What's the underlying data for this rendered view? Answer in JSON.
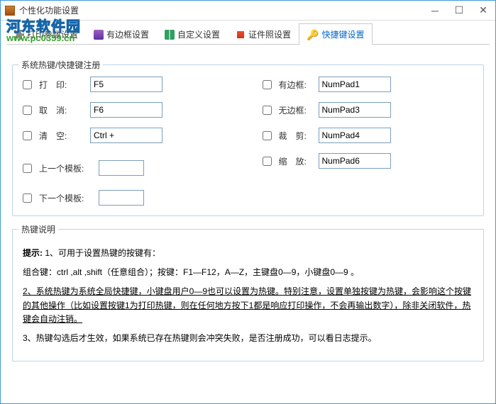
{
  "window": {
    "title": "个性化功能设置"
  },
  "tabs": {
    "items": [
      {
        "label": "打印参数设置"
      },
      {
        "label": "有边框设置"
      },
      {
        "label": "自定义设置"
      },
      {
        "label": "证件照设置"
      },
      {
        "label": "快捷键设置"
      }
    ]
  },
  "watermark": {
    "top_a": "河",
    "top_b": "东",
    "top_c": "软件园",
    "bottom": "www.pc0359.cn"
  },
  "hotkeys": {
    "legend": "系统热键/快捷键注册",
    "left": [
      {
        "label": "打　印:",
        "value": "F5"
      },
      {
        "label": "取　消:",
        "value": "F6"
      },
      {
        "label": "清　空:",
        "value": "Ctrl +"
      },
      {
        "label": "上一个模板:",
        "value": ""
      },
      {
        "label": "下一个模板:",
        "value": ""
      }
    ],
    "right": [
      {
        "label": "有边框:",
        "value": "NumPad1"
      },
      {
        "label": "无边框:",
        "value": "NumPad3"
      },
      {
        "label": "裁　剪:",
        "value": "NumPad4"
      },
      {
        "label": "缩　放:",
        "value": "NumPad6"
      }
    ]
  },
  "help": {
    "legend": "热键说明",
    "p1_label": "提示:",
    "p1": "1、可用于设置热键的按键有：",
    "p2": "组合键：ctrl ,alt ,shift（任意组合）；按键：F1—F12，A—Z，主键盘0—9，小键盘0—9 。",
    "p3": "2、系统热键为系统全局快捷键，小键盘用户0—9也可以设置为热键。特别注意，设置单独按键为热键，会影响这个按键的其他操作（比如设置按键1为打印热键，则在任何地方按下1都是响应打印操作，不会再输出数字），除非关闭软件，热键会自动注销。",
    "p4": "3、热键勾选后才生效，如果系统已存在热键则会冲突失败，是否注册成功，可以看日志提示。"
  }
}
